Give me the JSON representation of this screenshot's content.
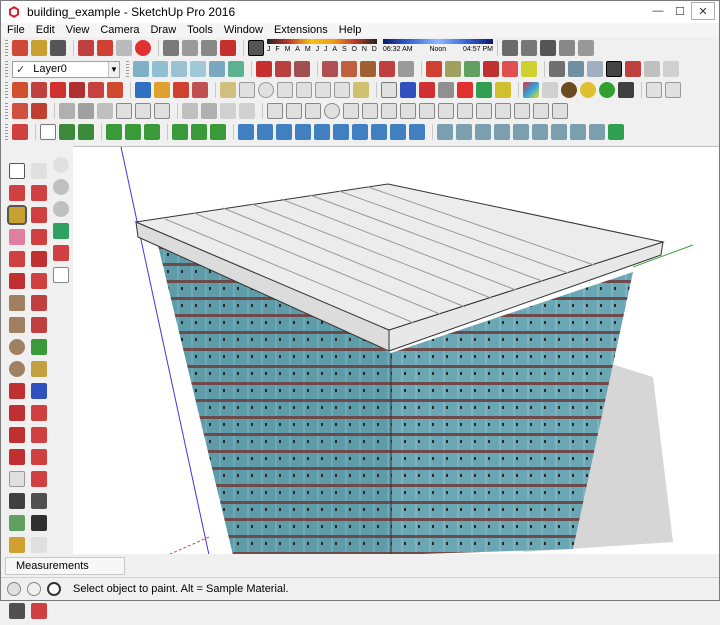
{
  "window": {
    "title": "building_example - SketchUp Pro 2016",
    "minimize_glyph": "—",
    "maximize_glyph": "☐",
    "close_glyph": "✕"
  },
  "menu": [
    "File",
    "Edit",
    "View",
    "Camera",
    "Draw",
    "Tools",
    "Window",
    "Extensions",
    "Help"
  ],
  "layers": {
    "current_layer": "Layer0"
  },
  "shadows": {
    "months": [
      "J",
      "F",
      "M",
      "A",
      "M",
      "J",
      "J",
      "A",
      "S",
      "O",
      "N",
      "D"
    ],
    "time_start": "06:32 AM",
    "time_mid": "Noon",
    "time_end": "04:57 PM"
  },
  "measurements": {
    "label": "Measurements"
  },
  "status": {
    "message": "Select object to paint. Alt = Sample Material."
  },
  "colors": {
    "axis_red": "#e04040",
    "axis_green": "#3aa63a",
    "axis_blue": "#3a3ae0",
    "facade": "#5d9aaa",
    "roof": "#ececec"
  },
  "icons": {
    "active_tool": "paint-bucket-icon"
  }
}
